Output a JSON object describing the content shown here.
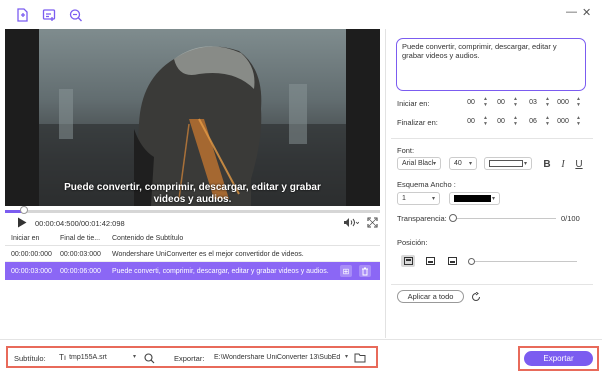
{
  "toolbar": {
    "add_file_icon": "add-file-icon",
    "add_subtitle_icon": "add-subtitle-icon",
    "search_subtitle_icon": "search-subtitle-icon",
    "window_controls": [
      "—",
      "✕"
    ]
  },
  "preview": {
    "subtitle_line1": "Puede convertir, comprimir, descargar, editar y grabar",
    "subtitle_line2": "videos y audios."
  },
  "player": {
    "time": "00:00:04:500/00:01:42:098",
    "progress": 0.04
  },
  "table": {
    "headers": [
      "Iniciar en",
      "Final de tie...",
      "Contenido de Subtítulo"
    ],
    "rows": [
      {
        "start": "00:00:00:000",
        "end": "00:00:03:000",
        "text": "Wondershare UniConverter es el mejor convertidor de videos.",
        "selected": false
      },
      {
        "start": "00:00:03:000",
        "end": "00:00:06:000",
        "text": "Puede converti, comprimir, descargar, editar y grabar videos y audios.",
        "selected": true
      }
    ]
  },
  "editor": {
    "text": "Puede convertir, comprimir, descargar, editar y grabar videos y audios.",
    "start_label": "Iniciar en:",
    "end_label": "Finalizar en:",
    "start_time": [
      "00",
      "00",
      "03",
      "000"
    ],
    "end_time": [
      "00",
      "00",
      "06",
      "000"
    ],
    "font_label": "Font:",
    "font_name": "Arial Blacl",
    "font_size": "40",
    "font_color": "#ffffff",
    "bold": "B",
    "italic": "I",
    "underline": "U",
    "outline_label": "Esquema Ancho :",
    "outline_width": "1",
    "outline_color": "#000000",
    "transparency_label": "Transparencia:",
    "transparency_value": "0/100",
    "position_label": "Posición:",
    "apply_all": "Aplicar a todo"
  },
  "bottom": {
    "subtitle_label": "Subtítulo:",
    "subtitle_file": "tmp155A.srt",
    "export_label": "Exportar:",
    "export_path": "E:\\Wondershare UniConverter 13\\SubEd",
    "export_button": "Exportar"
  },
  "colors": {
    "accent": "#7b5cf0",
    "highlight_border": "#e86a5a"
  }
}
